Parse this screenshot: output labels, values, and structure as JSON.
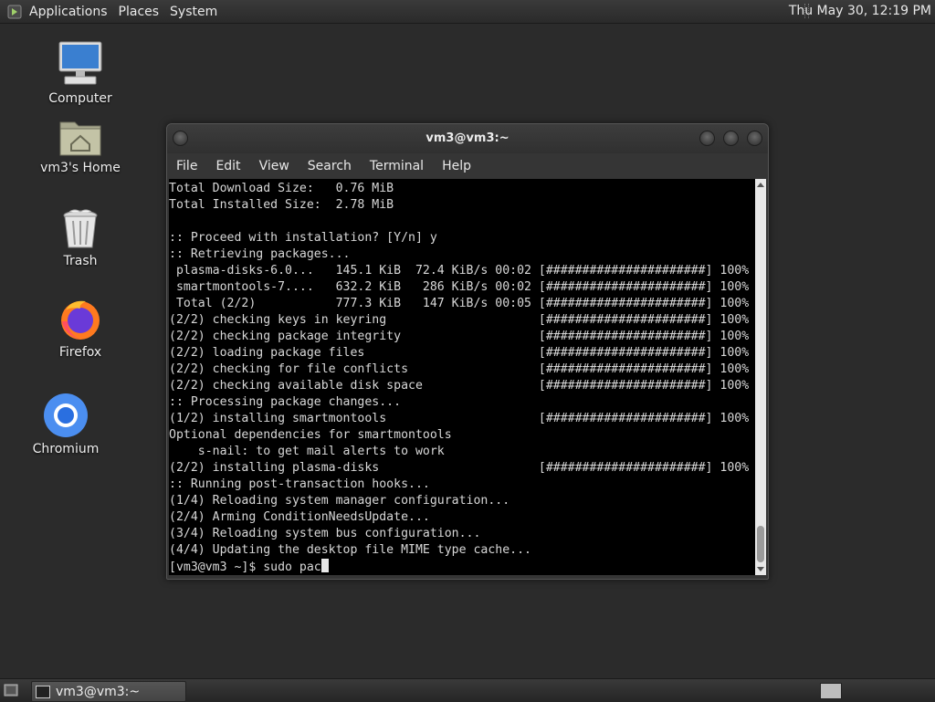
{
  "top_panel": {
    "menus": [
      "Applications",
      "Places",
      "System"
    ],
    "clock": "Thu May 30, 12:19 PM"
  },
  "desktop_icons": [
    {
      "label": "Computer",
      "icon": "computer-icon"
    },
    {
      "label": "vm3's Home",
      "icon": "home-folder-icon"
    },
    {
      "label": "Trash",
      "icon": "trash-icon"
    },
    {
      "label": "Firefox",
      "icon": "firefox-icon"
    },
    {
      "label": "Chromium",
      "icon": "chromium-icon"
    }
  ],
  "terminal": {
    "title": "vm3@vm3:~",
    "menus": [
      "File",
      "Edit",
      "View",
      "Search",
      "Terminal",
      "Help"
    ],
    "lines": [
      "Total Download Size:   0.76 MiB",
      "Total Installed Size:  2.78 MiB",
      "",
      ":: Proceed with installation? [Y/n] y",
      ":: Retrieving packages...",
      " plasma-disks-6.0...   145.1 KiB  72.4 KiB/s 00:02 [######################] 100%",
      " smartmontools-7....   632.2 KiB   286 KiB/s 00:02 [######################] 100%",
      " Total (2/2)           777.3 KiB   147 KiB/s 00:05 [######################] 100%",
      "(2/2) checking keys in keyring                     [######################] 100%",
      "(2/2) checking package integrity                   [######################] 100%",
      "(2/2) loading package files                        [######################] 100%",
      "(2/2) checking for file conflicts                  [######################] 100%",
      "(2/2) checking available disk space                [######################] 100%",
      ":: Processing package changes...",
      "(1/2) installing smartmontools                     [######################] 100%",
      "Optional dependencies for smartmontools",
      "    s-nail: to get mail alerts to work",
      "(2/2) installing plasma-disks                      [######################] 100%",
      ":: Running post-transaction hooks...",
      "(1/4) Reloading system manager configuration...",
      "(2/4) Arming ConditionNeedsUpdate...",
      "(3/4) Reloading system bus configuration...",
      "(4/4) Updating the desktop file MIME type cache..."
    ],
    "prompt": "[vm3@vm3 ~]$ sudo pac"
  },
  "bottom_panel": {
    "task_label": "vm3@vm3:~"
  }
}
